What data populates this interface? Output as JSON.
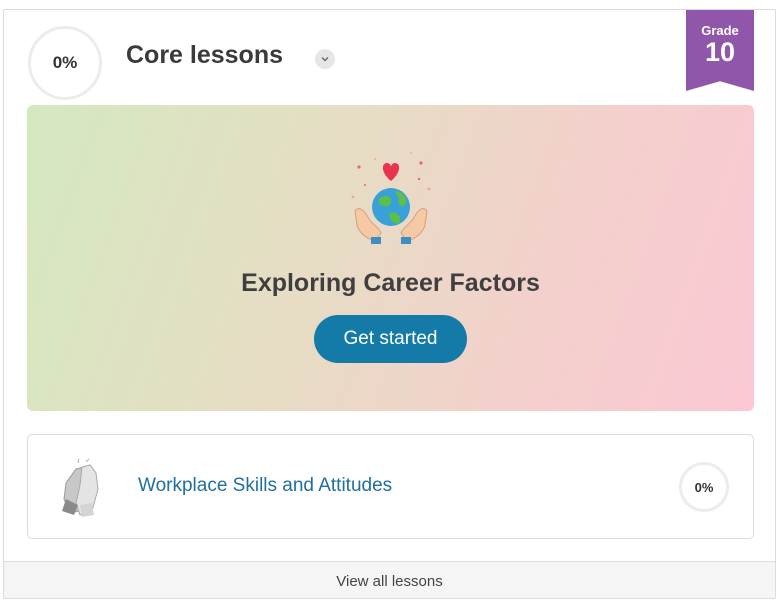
{
  "header": {
    "progress": "0%",
    "title": "Core lessons"
  },
  "grade": {
    "label": "Grade",
    "number": "10"
  },
  "hero": {
    "title": "Exploring Career Factors",
    "button_label": "Get started",
    "illustration_icon": "globe-in-hands-icon"
  },
  "lessons": [
    {
      "title": "Workplace Skills and Attitudes",
      "progress": "0%",
      "icon": "high-five-icon"
    }
  ],
  "footer": {
    "link_label": "View all lessons"
  },
  "colors": {
    "accent": "#147aa8",
    "grade_ribbon": "#8f56a9",
    "link": "#1f6fa0"
  }
}
